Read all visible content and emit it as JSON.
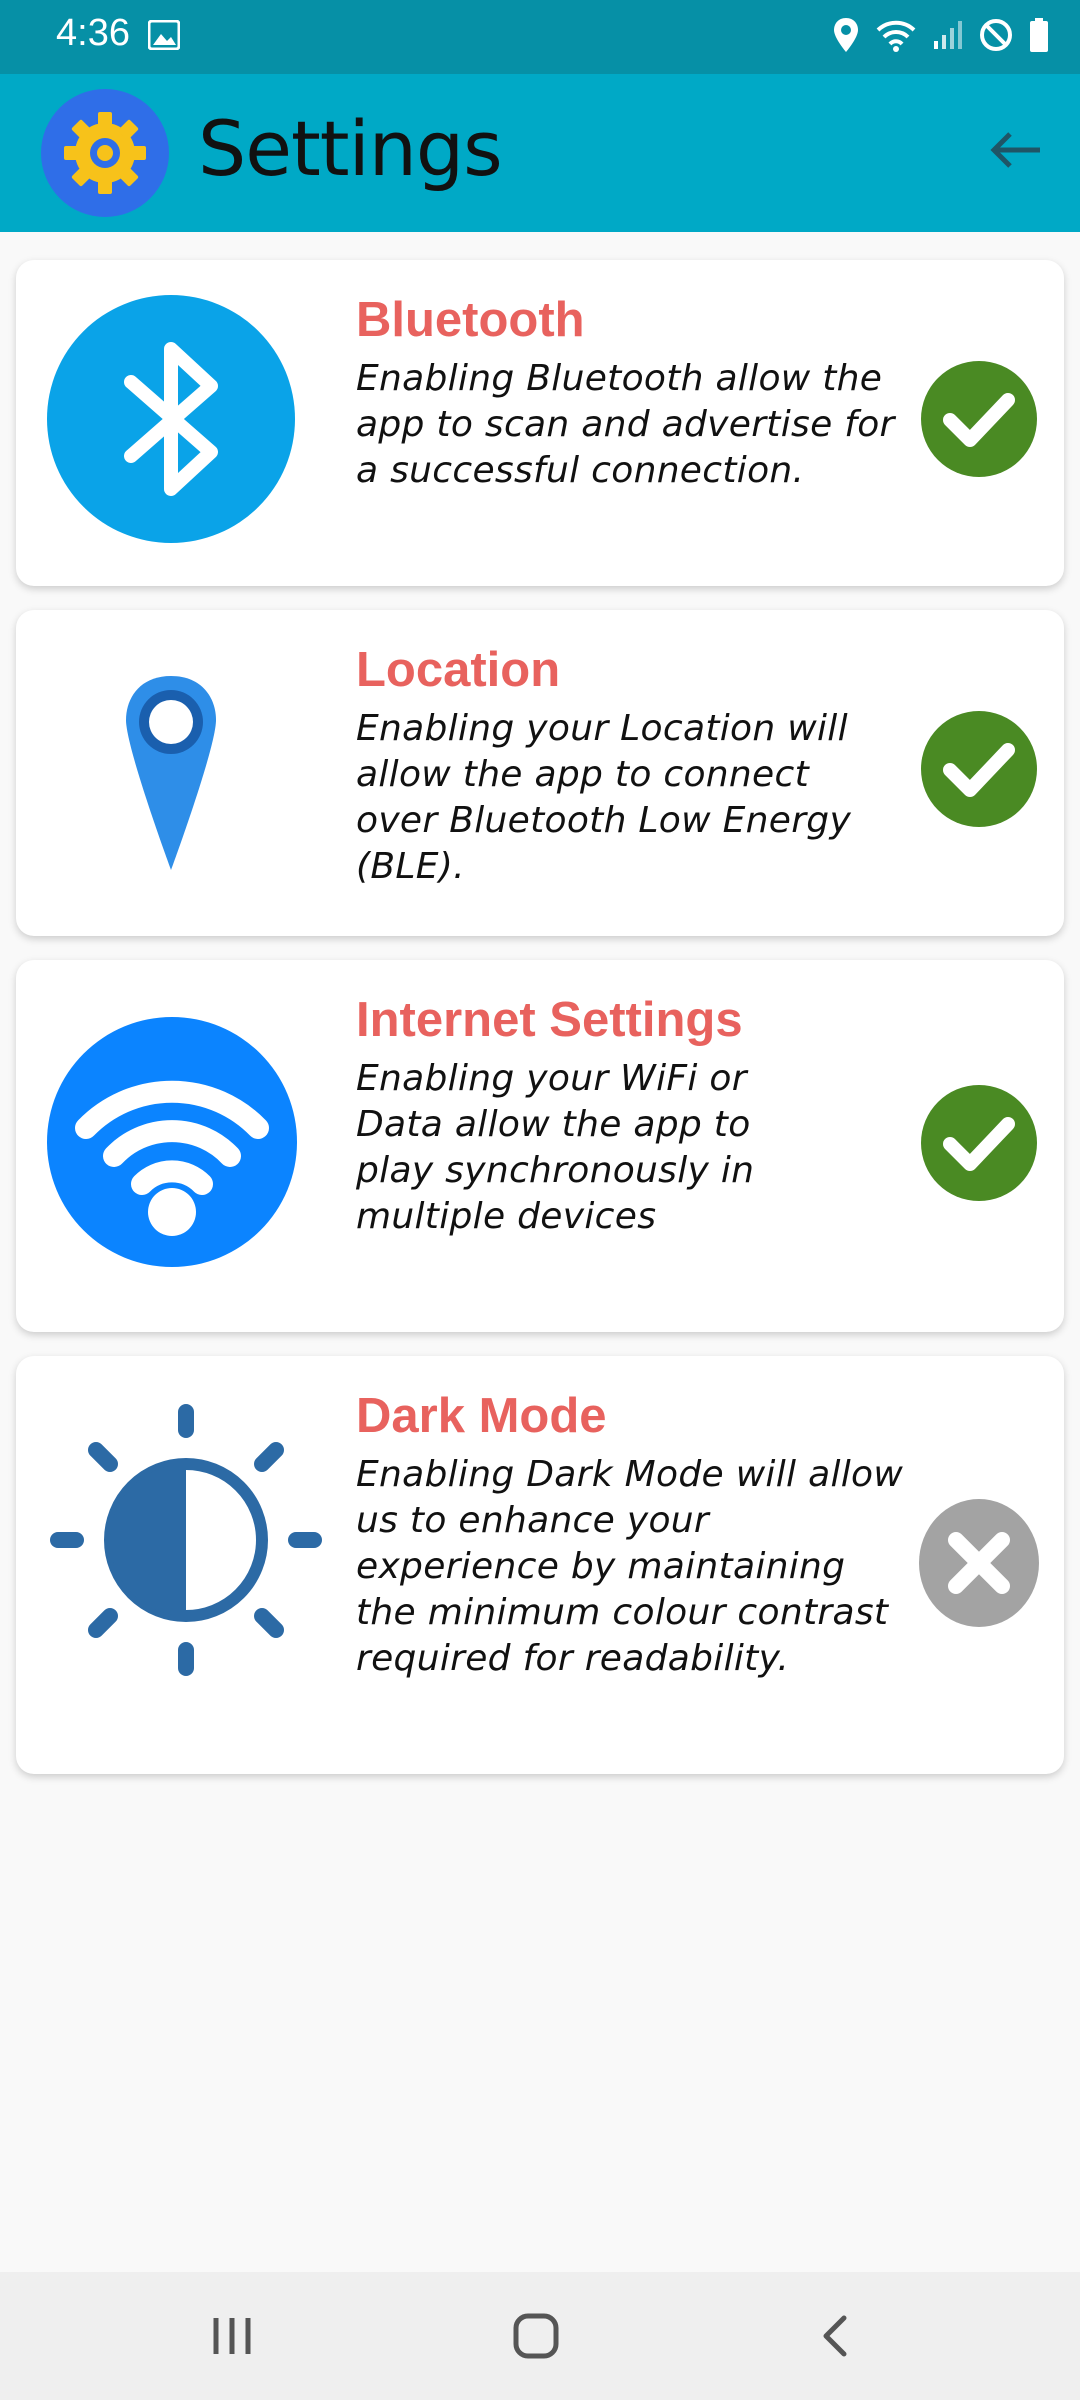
{
  "status_bar": {
    "time": "4:36",
    "icons": [
      "image-icon",
      "location-icon",
      "wifi-icon",
      "signal-icon",
      "do-not-disturb-icon",
      "battery-icon"
    ]
  },
  "app_bar": {
    "title": "Settings",
    "logo": "gear-icon",
    "back": "arrow-left-icon"
  },
  "settings": [
    {
      "title": "Bluetooth",
      "description": "Enabling Bluetooth allow the app to scan and advertise for a successful connection.",
      "icon": "bluetooth-icon",
      "enabled": true
    },
    {
      "title": "Location",
      "description": "Enabling your Location will allow the app to connect over Bluetooth Low Energy (BLE).",
      "icon": "location-pin-icon",
      "enabled": true
    },
    {
      "title": "Internet Settings",
      "description": "Enabling your WiFi or Data allow the app to play synchronously in multiple devices",
      "icon": "wifi-icon",
      "enabled": true
    },
    {
      "title": "Dark Mode",
      "description": "Enabling Dark Mode will allow us to enhance your experience by maintaining the minimum colour contrast required for readability.",
      "icon": "brightness-icon",
      "enabled": false
    }
  ],
  "colors": {
    "status_bar": "#0690a6",
    "app_bar": "#00a9c6",
    "title_red": "#e8625e",
    "enabled_green": "#4a8a23",
    "disabled_gray": "#a3a3a3",
    "bluetooth_blue": "#0aa3e8",
    "location_blue": "#2e8ee8",
    "wifi_blue": "#0b84ff",
    "dark_mode_blue": "#2c6aa5"
  },
  "nav_bar": {
    "buttons": [
      "recent-apps-icon",
      "home-icon",
      "back-icon"
    ]
  }
}
